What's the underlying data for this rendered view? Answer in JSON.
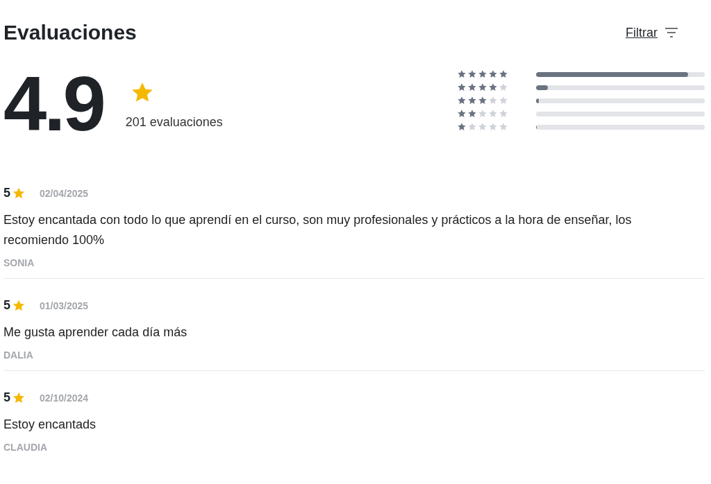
{
  "header": {
    "title": "Evaluaciones",
    "filter_link": "Filtrar"
  },
  "summary": {
    "average": "4.9",
    "count": "201 evaluaciones"
  },
  "breakdown": [
    {
      "stars": 5,
      "level": 0.9
    },
    {
      "stars": 4,
      "level": 0.07
    },
    {
      "stars": 3,
      "level": 0.015
    },
    {
      "stars": 2,
      "level": 0
    },
    {
      "stars": 1,
      "level": 0.006
    }
  ],
  "reviews": [
    {
      "score": "5",
      "date": "02/04/2025",
      "text": "Estoy encantada con todo lo que aprendí en el curso, son muy profesionales y prácticos a la hora de enseñar, los recomiendo 100%",
      "author": "SONIA"
    },
    {
      "score": "5",
      "date": "01/03/2025",
      "text": "Me gusta aprender cada día más",
      "author": "DALIA"
    },
    {
      "score": "5",
      "date": "02/10/2024",
      "text": "Estoy encantads",
      "author": "CLAUDIA"
    }
  ]
}
